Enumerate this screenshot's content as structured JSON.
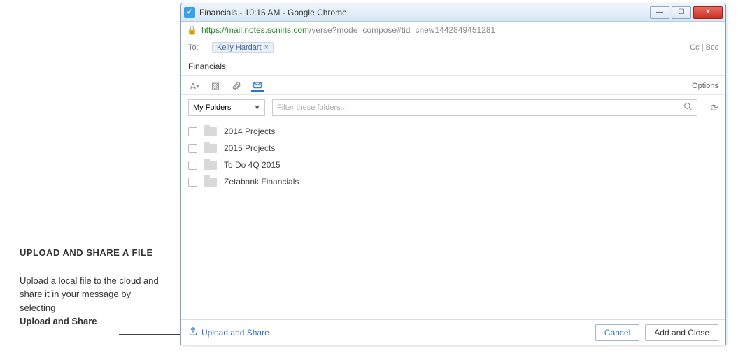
{
  "sidebar": {
    "heading": "UPLOAD AND SHARE A FILE",
    "body": "Upload a local file to the cloud and share it in your message by selecting",
    "bold_action": "Upload and Share"
  },
  "window": {
    "title": "Financials - 10:15 AM - Google Chrome",
    "url_scheme": "https://",
    "url_host": "mail.notes.scniris.com",
    "url_path": "/verse?mode=compose#tid=cnew1442849451281"
  },
  "compose": {
    "to_label": "To:",
    "recipient": "Kelly Hardart",
    "ccbcc": "Cc | Bcc",
    "subject": "Financials",
    "options_label": "Options",
    "dropdown_label": "My Folders",
    "filter_placeholder": "Filter these folders...",
    "folders": [
      "2014 Projects",
      "2015 Projects",
      "To Do 4Q 2015",
      "Zetabank Financials"
    ],
    "upload_label": "Upload and Share",
    "cancel_label": "Cancel",
    "add_close_label": "Add and Close"
  }
}
